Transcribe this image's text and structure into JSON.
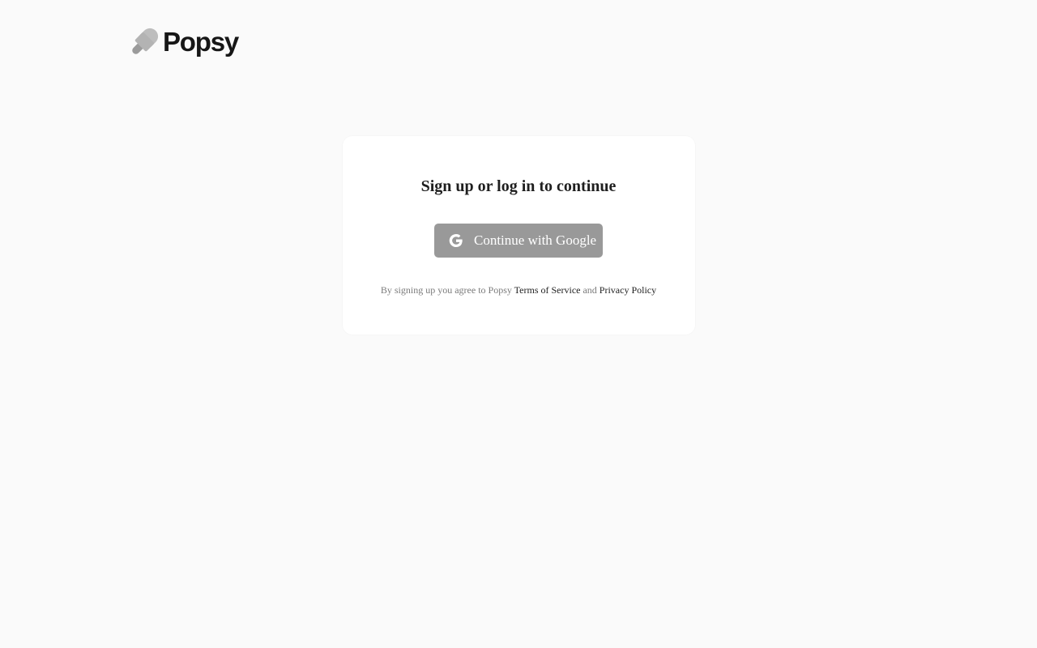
{
  "header": {
    "logo_text": "Popsy",
    "logo_icon": "popsicle-icon"
  },
  "auth_card": {
    "title": "Sign up or log in to continue",
    "google_button_label": "Continue with Google",
    "google_icon": "google-g-icon",
    "terms_prefix": "By signing up you agree to Popsy",
    "terms_link": "Terms of Service",
    "terms_and": "and",
    "privacy_link": "Privacy Policy"
  },
  "colors": {
    "background": "#fafafa",
    "card": "#ffffff",
    "button": "#999999",
    "text_dark": "#1f1f1f",
    "text_muted": "#7a7a7a"
  }
}
